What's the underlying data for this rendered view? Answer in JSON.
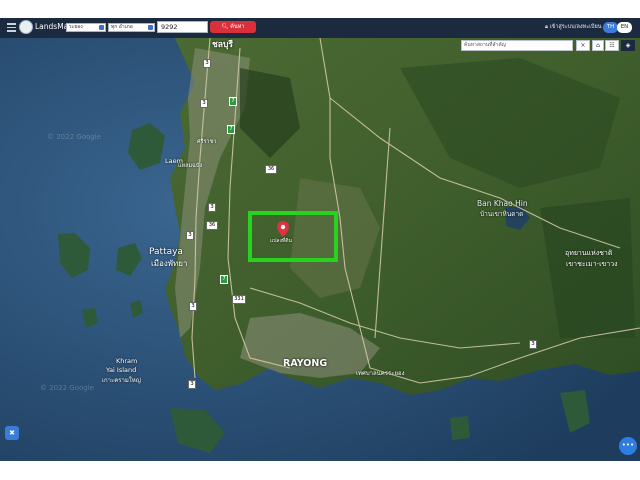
{
  "header": {
    "app_title": "LandsMaps",
    "province_select": "ระยอง",
    "district_select": "ทุก อำเภอ",
    "search_value": "9292",
    "search_button": "ค้นหา",
    "login_link": "เข้าสู่ระบบ/ลงทะเบียน",
    "lang_th": "TH",
    "lang_en": "EN",
    "menu_icon": "hamburger-menu-icon",
    "logo_icon": "landsmaps-logo-icon"
  },
  "map": {
    "place_search_placeholder": "ค้นหาสถานที่สำคัญ",
    "clear_label": "×",
    "home_icon": "home-icon",
    "ruler_icon": "ruler-icon",
    "layers_icon": "layers-icon",
    "watermark_top": "© 2022 Google",
    "watermark_bottom": "© 2022 Google",
    "labels": {
      "chonburi": "ชลบุรี",
      "laem_chabang": "Laem",
      "laem_chabang_th": "แหลมฉบัง",
      "si_racha": "ศรีราชา",
      "pattaya": "Pattaya",
      "mueang_pattaya": "เมืองพัทยา",
      "khram_island": "Khram",
      "khram_island_2": "Yai Island",
      "khram_island_th": "เกาะครามใหญ่",
      "rayong": "RAYONG",
      "rayong_th": "เทศบาลนครระยอง",
      "ban_khao_hin": "Ban Khao Hin",
      "ban_khao_hin_th": "บ้านเขาหินดาด",
      "national_park": "อุทยานแห่งชาติ",
      "national_park_2": "เขาชะเมา-เขาวง",
      "marker_label": "แปลงที่ดิน"
    },
    "road_shields": [
      "3",
      "7",
      "7",
      "36",
      "3",
      "3",
      "7",
      "331",
      "3",
      "3",
      "3",
      "3",
      "36"
    ],
    "highlight_color": "#27d31f",
    "marker_color": "#e0313f"
  },
  "fab_left_icon": "compass-icon",
  "fab_right_icon": "more-dots-icon"
}
